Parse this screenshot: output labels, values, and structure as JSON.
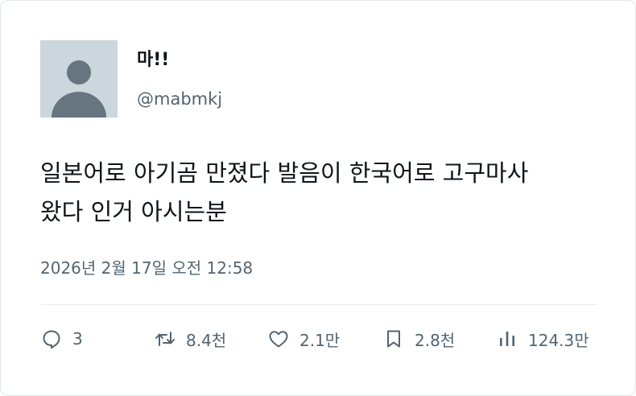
{
  "author": {
    "display_name": "마!!",
    "handle": "@mabmkj"
  },
  "tweet": {
    "text": "일본어로 아기곰 만졌다 발음이 한국어로 고구마사\n왔다 인거 아시는분",
    "timestamp": "2026년 2월 17일 오전 12:58"
  },
  "actions": {
    "reply_count": "3",
    "repost_count": "8.4천",
    "like_count": "2.1만",
    "bookmark_count": "2.8천",
    "view_count": "124.3만"
  },
  "colors": {
    "text_primary": "#0f1419",
    "text_secondary": "#536471",
    "avatar_bg": "#ccd6dd",
    "avatar_figure": "#66757f",
    "divider": "#e6ebee"
  },
  "icons": {
    "reply": "reply-bubble-icon",
    "repost": "repost-arrows-icon",
    "like": "heart-icon",
    "bookmark": "bookmark-icon",
    "views": "views-bar-chart-icon"
  }
}
